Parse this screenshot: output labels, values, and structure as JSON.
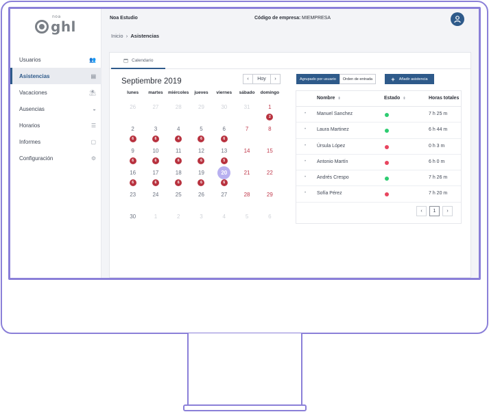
{
  "brand": {
    "small": "noa",
    "name": "ghl"
  },
  "sidebar": {
    "items": [
      {
        "label": "Usuarios",
        "icon": "users-icon"
      },
      {
        "label": "Asistencias",
        "icon": "clipboard-icon"
      },
      {
        "label": "Vacaciones",
        "icon": "beach-umbrella-icon"
      },
      {
        "label": "Ausencias",
        "icon": "sunglasses-icon"
      },
      {
        "label": "Horarios",
        "icon": "sliders-icon"
      },
      {
        "label": "Informes",
        "icon": "document-icon"
      },
      {
        "label": "Configuración",
        "icon": "gear-icon"
      }
    ],
    "active_index": 1
  },
  "header": {
    "company": "Noa Estudio",
    "code_label": "Código de empresa:",
    "code_value": "MIEMPRESA",
    "breadcrumb": {
      "home": "Inicio",
      "separator": "›",
      "current": "Asistencias"
    }
  },
  "tabs": [
    {
      "label": "Calendario",
      "icon": "calendar-icon"
    }
  ],
  "calendar": {
    "title": "Septiembre 2019",
    "today_label": "Hoy",
    "prev": "‹",
    "next": "›",
    "weekdays": [
      "lunes",
      "martes",
      "miércoles",
      "jueves",
      "viernes",
      "sábado",
      "domingo"
    ],
    "weeks": [
      [
        {
          "d": "26",
          "muted": true
        },
        {
          "d": "27",
          "muted": true
        },
        {
          "d": "28",
          "muted": true
        },
        {
          "d": "29",
          "muted": true
        },
        {
          "d": "30",
          "muted": true
        },
        {
          "d": "31",
          "muted": true
        },
        {
          "d": "1",
          "weekend": true,
          "badge": "2"
        }
      ],
      [
        {
          "d": "2",
          "badge": "6"
        },
        {
          "d": "3",
          "badge": "6"
        },
        {
          "d": "4",
          "badge": "4"
        },
        {
          "d": "5",
          "badge": "6"
        },
        {
          "d": "6",
          "badge": "6"
        },
        {
          "d": "7",
          "weekend": true
        },
        {
          "d": "8",
          "weekend": true
        }
      ],
      [
        {
          "d": "9",
          "badge": "6"
        },
        {
          "d": "10",
          "badge": "6"
        },
        {
          "d": "11",
          "badge": "6"
        },
        {
          "d": "12",
          "badge": "6"
        },
        {
          "d": "13",
          "badge": "5"
        },
        {
          "d": "14",
          "weekend": true
        },
        {
          "d": "15",
          "weekend": true
        }
      ],
      [
        {
          "d": "16",
          "badge": "6"
        },
        {
          "d": "17",
          "badge": "6"
        },
        {
          "d": "18",
          "badge": "6"
        },
        {
          "d": "19",
          "badge": "6"
        },
        {
          "d": "20",
          "selected": true,
          "badge": "6"
        },
        {
          "d": "21",
          "weekend": true
        },
        {
          "d": "22",
          "weekend": true
        }
      ],
      [
        {
          "d": "23"
        },
        {
          "d": "24"
        },
        {
          "d": "25"
        },
        {
          "d": "26"
        },
        {
          "d": "27"
        },
        {
          "d": "28",
          "weekend": true
        },
        {
          "d": "29",
          "weekend": true
        }
      ],
      [
        {
          "d": "30"
        },
        {
          "d": "1",
          "muted": true
        },
        {
          "d": "2",
          "muted": true
        },
        {
          "d": "3",
          "muted": true
        },
        {
          "d": "4",
          "muted": true
        },
        {
          "d": "5",
          "muted": true
        },
        {
          "d": "6",
          "muted": true
        }
      ]
    ]
  },
  "toolbar": {
    "group_by_user": "Agrupado por usuario",
    "entry_order": "Orden de entrada",
    "add_label": "Añadir asistencia",
    "add_icon": "+"
  },
  "table": {
    "columns": [
      "Nombre",
      "Estado",
      "Horas totales"
    ],
    "sort_glyph": "⇕",
    "expand_glyph": "•",
    "rows": [
      {
        "name": "Manuel Sanchez",
        "status": "active",
        "hours": "7 h 25 m"
      },
      {
        "name": "Laura Martinez",
        "status": "active",
        "hours": "6 h 44 m"
      },
      {
        "name": "Úrsula López",
        "status": "inactive",
        "hours": "0 h 3 m"
      },
      {
        "name": "Antonio Martín",
        "status": "inactive",
        "hours": "6 h 0 m"
      },
      {
        "name": "Andrés Crespo",
        "status": "active",
        "hours": "7 h 26 m"
      },
      {
        "name": "Sofía Pérez",
        "status": "inactive",
        "hours": "7 h 20 m"
      }
    ],
    "pagination": {
      "prev": "‹",
      "current": "1",
      "next": "›"
    }
  },
  "colors": {
    "accent": "#2e5a8a",
    "status_active": "#2ecc71",
    "status_inactive": "#e8455f",
    "badge": "#b8323f",
    "selected_day": "#b8b0f0",
    "frame": "#8a7fd8"
  }
}
